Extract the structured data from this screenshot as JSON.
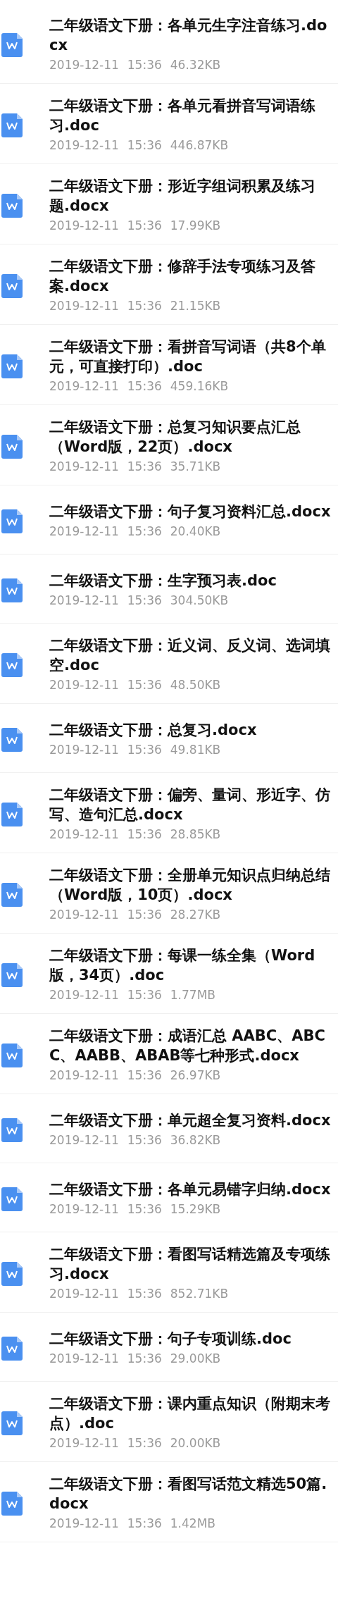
{
  "files": [
    {
      "name": "二年级语文下册：各单元生字注音练习.docx",
      "date": "2019-12-11",
      "time": "15:36",
      "size": "46.32KB"
    },
    {
      "name": "二年级语文下册：各单元看拼音写词语练习.doc",
      "date": "2019-12-11",
      "time": "15:36",
      "size": "446.87KB"
    },
    {
      "name": "二年级语文下册：形近字组词积累及练习题.docx",
      "date": "2019-12-11",
      "time": "15:36",
      "size": "17.99KB"
    },
    {
      "name": "二年级语文下册：修辞手法专项练习及答案.docx",
      "date": "2019-12-11",
      "time": "15:36",
      "size": "21.15KB"
    },
    {
      "name": "二年级语文下册：看拼音写词语（共8个单元，可直接打印）.doc",
      "date": "2019-12-11",
      "time": "15:36",
      "size": "459.16KB"
    },
    {
      "name": "二年级语文下册：总复习知识要点汇总（Word版，22页）.docx",
      "date": "2019-12-11",
      "time": "15:36",
      "size": "35.71KB"
    },
    {
      "name": "二年级语文下册：句子复习资料汇总.docx",
      "date": "2019-12-11",
      "time": "15:36",
      "size": "20.40KB"
    },
    {
      "name": "二年级语文下册：生字预习表.doc",
      "date": "2019-12-11",
      "time": "15:36",
      "size": "304.50KB"
    },
    {
      "name": "二年级语文下册：近义词、反义词、选词填空.doc",
      "date": "2019-12-11",
      "time": "15:36",
      "size": "48.50KB"
    },
    {
      "name": "二年级语文下册：总复习.docx",
      "date": "2019-12-11",
      "time": "15:36",
      "size": "49.81KB"
    },
    {
      "name": "二年级语文下册：偏旁、量词、形近字、仿写、造句汇总.docx",
      "date": "2019-12-11",
      "time": "15:36",
      "size": "28.85KB"
    },
    {
      "name": "二年级语文下册：全册单元知识点归纳总结（Word版，10页）.docx",
      "date": "2019-12-11",
      "time": "15:36",
      "size": "28.27KB"
    },
    {
      "name": "二年级语文下册：每课一练全集（Word版，34页）.doc",
      "date": "2019-12-11",
      "time": "15:36",
      "size": "1.77MB"
    },
    {
      "name": "二年级语文下册：成语汇总 AABC、ABCC、AABB、ABAB等七种形式.docx",
      "date": "2019-12-11",
      "time": "15:36",
      "size": "26.97KB"
    },
    {
      "name": "二年级语文下册：单元超全复习资料.docx",
      "date": "2019-12-11",
      "time": "15:36",
      "size": "36.82KB"
    },
    {
      "name": "二年级语文下册：各单元易错字归纳.docx",
      "date": "2019-12-11",
      "time": "15:36",
      "size": "15.29KB"
    },
    {
      "name": "二年级语文下册：看图写话精选篇及专项练习.docx",
      "date": "2019-12-11",
      "time": "15:36",
      "size": "852.71KB"
    },
    {
      "name": "二年级语文下册：句子专项训练.doc",
      "date": "2019-12-11",
      "time": "15:36",
      "size": "29.00KB"
    },
    {
      "name": "二年级语文下册：课内重点知识（附期末考点）.doc",
      "date": "2019-12-11",
      "time": "15:36",
      "size": "20.00KB"
    },
    {
      "name": "二年级语文下册：看图写话范文精选50篇.docx",
      "date": "2019-12-11",
      "time": "15:36",
      "size": "1.42MB"
    }
  ]
}
